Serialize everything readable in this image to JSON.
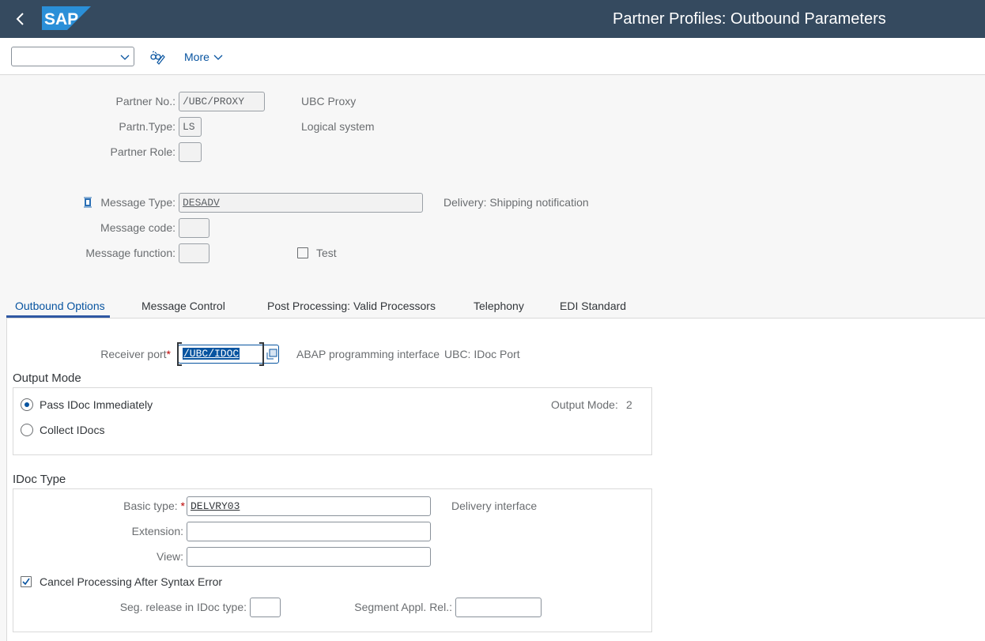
{
  "shell": {
    "title": "Partner Profiles: Outbound Parameters",
    "logo_text": "SAP"
  },
  "toolbar": {
    "dropdown_value": "",
    "more_label": "More"
  },
  "header": {
    "partner_no_label": "Partner No.:",
    "partner_no_value": "/UBC/PROXY",
    "partner_no_desc": "UBC Proxy",
    "partn_type_label": "Partn.Type:",
    "partn_type_value": "LS",
    "partn_type_desc": "Logical system",
    "partner_role_label": "Partner Role:",
    "partner_role_value": "",
    "message_type_label": "Message Type:",
    "message_type_value": "DESADV",
    "message_type_desc": "Delivery: Shipping notification",
    "message_code_label": "Message code:",
    "message_code_value": "",
    "message_function_label": "Message function:",
    "message_function_value": "",
    "test_label": "Test",
    "test_checked": false
  },
  "tabs": [
    {
      "label": "Outbound Options",
      "active": true
    },
    {
      "label": "Message Control",
      "active": false
    },
    {
      "label": "Post Processing: Valid Processors",
      "active": false
    },
    {
      "label": "Telephony",
      "active": false
    },
    {
      "label": "EDI Standard",
      "active": false
    }
  ],
  "outbound": {
    "receiver_port_label": "Receiver port",
    "receiver_port_value": "/UBC/IDOC",
    "receiver_port_type": "ABAP programming interface",
    "receiver_port_desc": "UBC: IDoc Port",
    "output_mode_title": "Output Mode",
    "radio_pass": "Pass IDoc Immediately",
    "radio_collect": "Collect IDocs",
    "selected_mode": "Pass IDoc Immediately",
    "output_mode_label": "Output Mode:",
    "output_mode_value": "2",
    "idoc_type_title": "IDoc Type",
    "basic_type_label": "Basic type:",
    "basic_type_value": "DELVRY03",
    "basic_type_desc": "Delivery interface",
    "extension_label": "Extension:",
    "extension_value": "",
    "view_label": "View:",
    "view_value": "",
    "cancel_processing_label": "Cancel Processing After Syntax Error",
    "cancel_processing_checked": true,
    "seg_release_label": "Seg. release in IDoc type:",
    "seg_release_value": "",
    "segment_appl_rel_label": "Segment Appl. Rel.:",
    "segment_appl_rel_value": ""
  },
  "colors": {
    "shell_bg": "#354a5f",
    "accent": "#0854a0",
    "required": "#bb0000"
  }
}
